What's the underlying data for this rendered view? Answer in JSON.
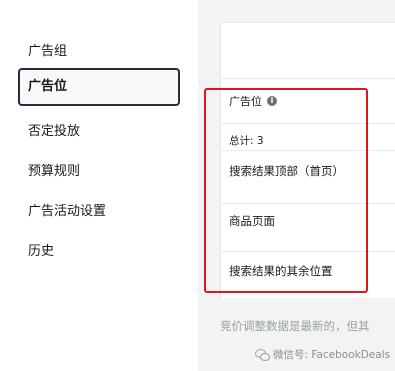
{
  "sidebar": {
    "items": [
      {
        "label": "广告组"
      },
      {
        "label": "广告位"
      },
      {
        "label": "否定投放"
      },
      {
        "label": "预算规则"
      },
      {
        "label": "广告活动设置"
      },
      {
        "label": "历史"
      }
    ]
  },
  "table": {
    "column_header": "广告位",
    "total": "总计: 3",
    "rows": [
      {
        "label": "搜索结果顶部（首页）"
      },
      {
        "label": "商品页面"
      },
      {
        "label": "搜索结果的其余位置"
      }
    ]
  },
  "note": "竞价调整数据是最新的，但其",
  "watermark": "微信号: FacebookDeals",
  "colors": {
    "highlight": "#e0161e",
    "active_border": "#232f3e"
  }
}
